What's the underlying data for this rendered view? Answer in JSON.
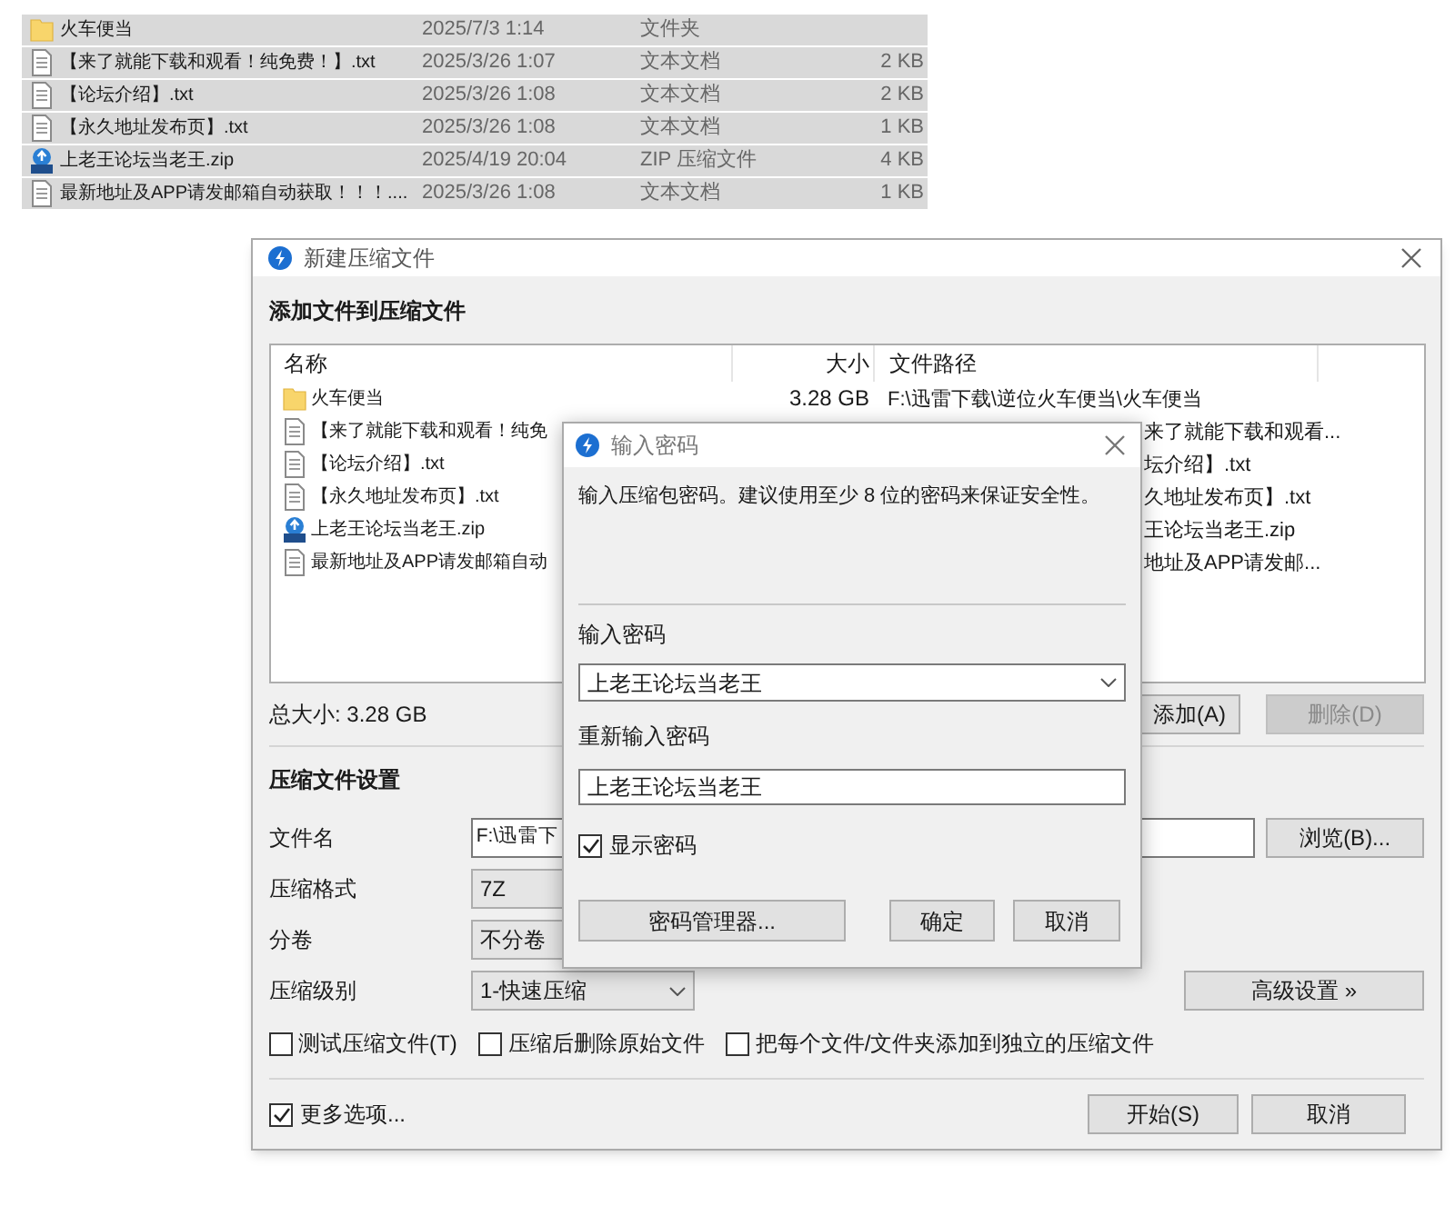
{
  "explorer_files": [
    {
      "name": "火车便当",
      "modified": "2025/7/3 1:14",
      "type": "文件夹",
      "kind": "folder",
      "selected": true
    },
    {
      "name": "【来了就能下载和观看！纯免费！】.txt",
      "modified": "2025/3/26 1:07",
      "type": "文本文档",
      "size": "2 KB",
      "kind": "text",
      "selected": true
    },
    {
      "name": "【论坛介绍】.txt",
      "modified": "2025/3/26 1:08",
      "type": "文本文档",
      "size": "2 KB",
      "kind": "text",
      "selected": true
    },
    {
      "name": "【永久地址发布页】.txt",
      "modified": "2025/3/26 1:08",
      "type": "文本文档",
      "size": "1 KB",
      "kind": "text",
      "selected": true
    },
    {
      "name": "上老王论坛当老王.zip",
      "modified": "2025/4/19 20:04",
      "type": "ZIP 压缩文件",
      "size": "4 KB",
      "kind": "zip",
      "selected": true
    },
    {
      "name": "最新地址及APP请发邮箱自动获取！！！....",
      "modified": "2025/3/26 1:08",
      "type": "文本文档",
      "size": "1 KB",
      "kind": "text",
      "selected": true
    }
  ],
  "archive_dialog": {
    "title": "新建压缩文件",
    "heading": "添加文件到压缩文件",
    "columns": [
      "名称",
      "大小",
      "文件路径"
    ],
    "files": [
      {
        "name": "火车便当",
        "size": "3.28 GB",
        "path": "F:\\迅雷下载\\逆位火车便当\\火车便当",
        "path_clipped": false,
        "kind": "folder"
      },
      {
        "name": "【来了就能下载和观看！纯免",
        "path": "来了就能下载和观看...",
        "path_clipped": true,
        "kind": "text"
      },
      {
        "name": "【论坛介绍】.txt",
        "path": "坛介绍】.txt",
        "path_clipped": true,
        "kind": "text"
      },
      {
        "name": "【永久地址发布页】.txt",
        "path": "久地址发布页】.txt",
        "path_clipped": true,
        "kind": "text"
      },
      {
        "name": "上老王论坛当老王.zip",
        "path": "王论坛当老王.zip",
        "path_clipped": true,
        "kind": "zip"
      },
      {
        "name": "最新地址及APP请发邮箱自动",
        "path": "地址及APP请发邮...",
        "path_clipped": true,
        "kind": "text"
      }
    ],
    "total_size": "总大小: 3.28 GB",
    "add_button": {
      "label": "添加(A)",
      "disabled": false
    },
    "delete_button": {
      "label": "删除(D)",
      "disabled": true
    },
    "settings_heading": "压缩文件设置",
    "fields": [
      {
        "label": "文件名",
        "kind": "input",
        "value": "F:\\迅雷下"
      },
      {
        "label": "压缩格式",
        "kind": "dropdown",
        "value": "7Z"
      },
      {
        "label": "分卷",
        "kind": "dropdown",
        "value": "不分卷"
      },
      {
        "label": "压缩级别",
        "kind": "dropdown",
        "value": "1-快速压缩"
      }
    ],
    "browse_button": "浏览(B)...",
    "advanced_button": "高级设置 »",
    "options": [
      {
        "label": "测试压缩文件(T)",
        "checked": false
      },
      {
        "label": "压缩后删除原始文件",
        "checked": false
      },
      {
        "label": "把每个文件/文件夹添加到独立的压缩文件",
        "checked": false
      }
    ],
    "more_options": {
      "label": "更多选项...",
      "checked": true
    },
    "start_button": "开始(S)",
    "cancel_button": "取消"
  },
  "password_dialog": {
    "title": "输入密码",
    "hint": "输入压缩包密码。建议使用至少 8 位的密码来保证安全性。",
    "password_label": "输入密码",
    "password_value": "上老王论坛当老王",
    "confirm_label": "重新输入密码",
    "confirm_value": "上老王论坛当老王",
    "show_password": {
      "label": "显示密码",
      "checked": true
    },
    "manager_button": "密码管理器...",
    "ok_button": "确定",
    "cancel_button": "取消"
  }
}
